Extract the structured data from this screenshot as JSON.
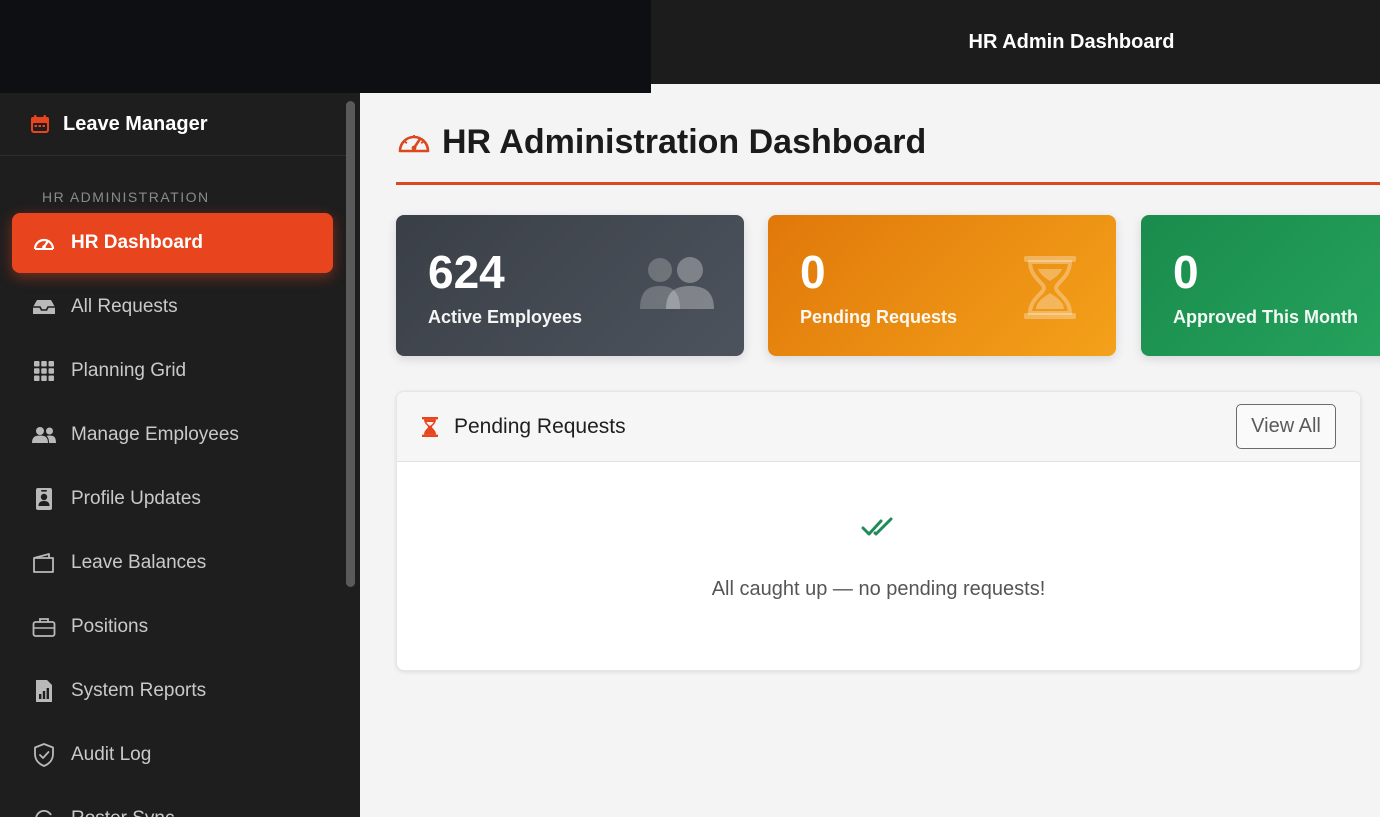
{
  "header": {
    "title": "HR Admin Dashboard"
  },
  "sidebar": {
    "brand": {
      "label": "Leave Manager",
      "icon": "calendar-icon"
    },
    "section_title": "HR ADMINISTRATION",
    "items": [
      {
        "label": "HR Dashboard",
        "icon": "gauge-icon",
        "active": true
      },
      {
        "label": "All Requests",
        "icon": "inbox-icon"
      },
      {
        "label": "Planning Grid",
        "icon": "grid-icon"
      },
      {
        "label": "Manage Employees",
        "icon": "users-icon"
      },
      {
        "label": "Profile Updates",
        "icon": "id-card-icon"
      },
      {
        "label": "Leave Balances",
        "icon": "wallet-icon"
      },
      {
        "label": "Positions",
        "icon": "briefcase-icon"
      },
      {
        "label": "System Reports",
        "icon": "report-icon"
      },
      {
        "label": "Audit Log",
        "icon": "shield-icon"
      },
      {
        "label": "Roster Sync",
        "icon": "sync-icon"
      }
    ]
  },
  "main": {
    "page_title": "HR Administration Dashboard",
    "stats": [
      {
        "value": "624",
        "label": "Active Employees",
        "icon": "users-icon"
      },
      {
        "value": "0",
        "label": "Pending Requests",
        "icon": "hourglass-icon"
      },
      {
        "value": "0",
        "label": "Approved This Month",
        "icon": "check-icon"
      }
    ],
    "pending_panel": {
      "title": "Pending Requests",
      "view_all_label": "View All",
      "empty_message": "All caught up — no pending requests!"
    }
  },
  "colors": {
    "accent": "#e8451f",
    "sidebar_bg": "#1e1e1e",
    "card_employees": "#3a3f47",
    "card_pending": "#f0950f",
    "card_approved": "#1d9451",
    "success": "#1f8a5a"
  }
}
